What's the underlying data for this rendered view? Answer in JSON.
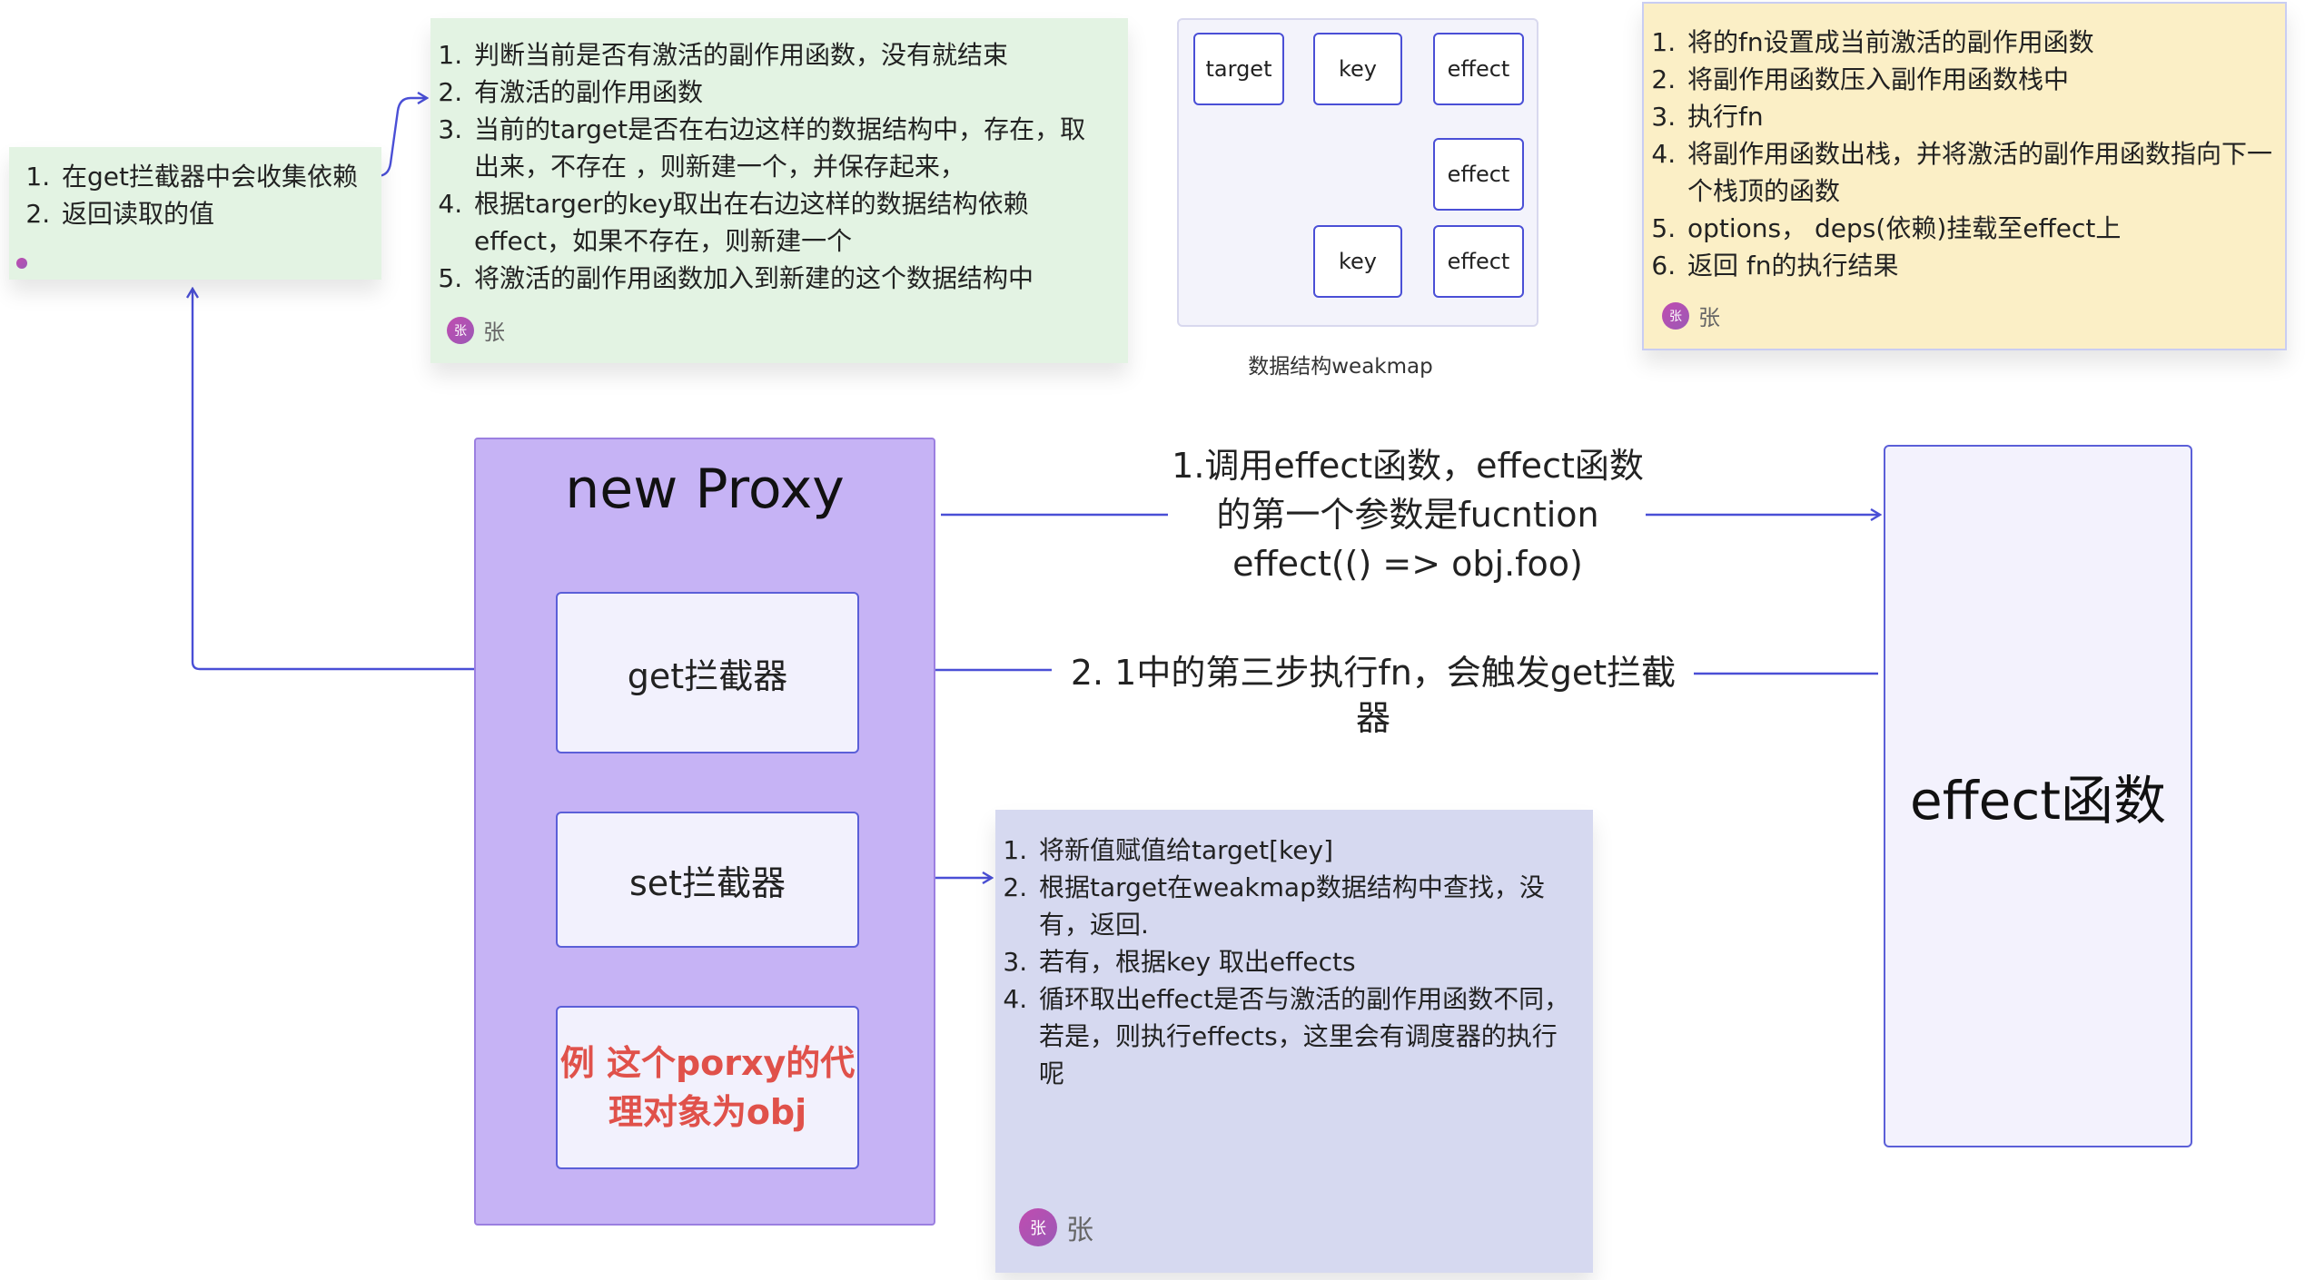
{
  "left_note": {
    "items": [
      "在get拦截器中会收集依赖",
      "返回读取的值"
    ]
  },
  "green_note": {
    "items": [
      "判断当前是否有激活的副作用函数，没有就结束",
      "有激活的副作用函数",
      "当前的target是否在右边这样的数据结构中，存在，取出来，不存在 ，则新建一个，并保存起来，",
      "根据targer的key取出在右边这样的数据结构依赖effect，如果不存在，则新建一个",
      "将激活的副作用函数加入到新建的这个数据结构中"
    ],
    "author": "张"
  },
  "weakmap": {
    "nodes": {
      "target": "target",
      "key1": "key",
      "effect1": "effect",
      "effect2": "effect",
      "key2": "key",
      "effect3": "effect"
    },
    "caption": "数据结构weakmap"
  },
  "yellow_note": {
    "items": [
      "将的fn设置成当前激活的副作用函数",
      "将副作用函数压入副作用函数栈中",
      "执行fn",
      "将副作用函数出栈，并将激活的副作用函数指向下一个栈顶的函数",
      "options， deps(依赖)挂载至effect上",
      "返回 fn的执行结果"
    ],
    "author": "张"
  },
  "proxy": {
    "title": "new Proxy",
    "get_label": "get拦截器",
    "set_label": "set拦截器",
    "example_line1": "例 这个porxy的代",
    "example_line2": "理对象为obj"
  },
  "arrow1": {
    "line1": "1.调用effect函数，effect函数",
    "line2": "的第一个参数是fucntion",
    "line3": "effect(() => obj.foo)"
  },
  "arrow2": {
    "label": "2. 1中的第三步执行fn，会触发get拦截器"
  },
  "effect_box": {
    "label": "effect函数"
  },
  "blue_note": {
    "items": [
      "将新值赋值给target[key]",
      "根据target在weakmap数据结构中查找，没有，返回.",
      "若有，根据key 取出effects",
      "循环取出effect是否与激活的副作用函数不同，若是，则执行effects，这里会有调度器的执行呢"
    ],
    "author": "张"
  },
  "colors": {
    "green_note": "#e3f3e3",
    "yellow_note": "#fbefc6",
    "blue_note": "#d6d9f0",
    "proxy": "#c6b3f5",
    "connector": "#4a4fd6",
    "example_text": "#e0514a"
  }
}
